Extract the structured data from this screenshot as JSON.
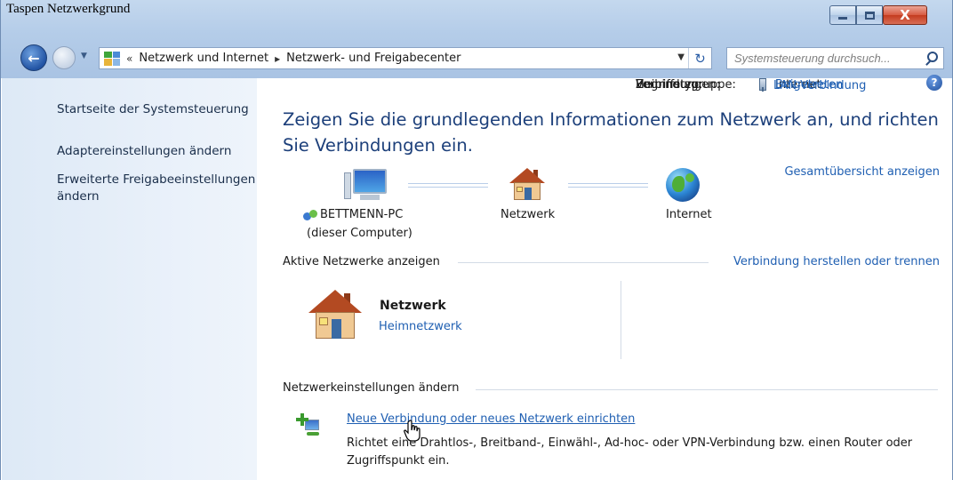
{
  "page_top_text": "Taspen Netzwerkgrund",
  "window_buttons": {
    "minimize": "",
    "maximize": "",
    "close": "X"
  },
  "nav": {
    "back_glyph": "←",
    "recent_glyph": "▼",
    "breadcrumb_overflow": "«",
    "breadcrumb": [
      "Netzwerk und Internet",
      "Netzwerk- und Freigabecenter"
    ],
    "separator": "▸",
    "dropdown_glyph": "▼",
    "refresh_glyph": "↻",
    "search_placeholder": "Systemsteuerung durchsuch..."
  },
  "sidebar": {
    "items": [
      {
        "label": "Startseite der Systemsteuerung"
      },
      {
        "label": "Adaptereinstellungen ändern"
      },
      {
        "label": "Erweiterte Freigabeeinstellungen ändern"
      }
    ]
  },
  "main": {
    "help_glyph": "?",
    "title": "Zeigen Sie die grundlegenden Informationen zum Netzwerk an, und richten Sie Verbindungen ein.",
    "map": {
      "full_map_link": "Gesamtübersicht anzeigen",
      "computer_name": "BETTMENN-PC",
      "computer_sub": "(dieser Computer)",
      "network_label": "Netzwerk",
      "internet_label": "Internet"
    },
    "active": {
      "header": "Aktive Netzwerke anzeigen",
      "connect_link": "Verbindung herstellen oder trennen",
      "network_name": "Netzwerk",
      "network_type": "Heimnetzwerk",
      "properties": [
        {
          "label": "Zugriffstyp:",
          "value": "Internet"
        },
        {
          "label": "Heimnetzgruppe:",
          "value": "Beigetreten"
        },
        {
          "label": "Verbindungen:",
          "value": "LAN-Verbindung"
        }
      ]
    },
    "settings": {
      "header": "Netzwerkeinstellungen ändern",
      "new_connection_link": "Neue Verbindung oder neues Netzwerk einrichten",
      "new_connection_desc": "Richtet eine Drahtlos-, Breitband-, Einwähl-, Ad-hoc- oder VPN-Verbindung bzw. einen Router oder Zugriffspunkt ein."
    }
  },
  "colors": {
    "link": "#1f5fb2",
    "title": "#1c3f7a",
    "sidebar_bg": "#dde9f6"
  }
}
